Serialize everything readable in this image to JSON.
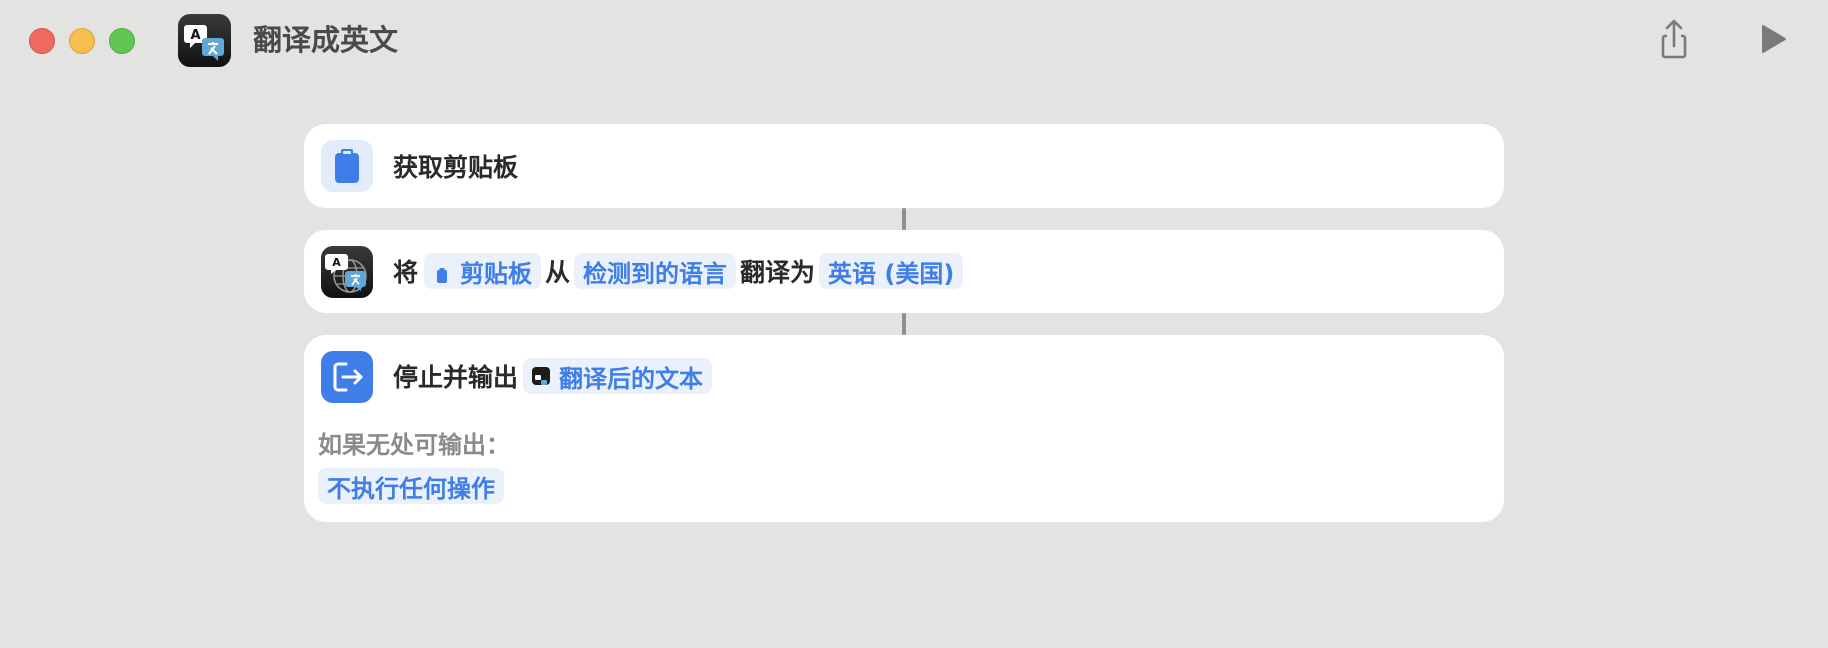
{
  "window": {
    "title": "翻译成英文",
    "traffic_lights": {
      "close": "#ee6a5f",
      "minimize": "#f5be4f",
      "zoom": "#62c655"
    },
    "share_icon": "share-icon",
    "run_icon": "play-icon"
  },
  "actions": [
    {
      "icon": "clipboard-icon",
      "text": "获取剪贴板"
    },
    {
      "icon": "translate-icon",
      "prefix": "将",
      "input_token": "剪贴板",
      "from_word": "从",
      "source_language": "检测到的语言",
      "to_word": "翻译为",
      "target_language": "英语 (美国)"
    },
    {
      "icon": "exit-icon",
      "text": "停止并输出",
      "output_token": "翻译后的文本",
      "fallback_label": "如果无处可输出：",
      "fallback_value": "不执行任何操作"
    }
  ],
  "colors": {
    "accent": "#3f7ee8",
    "token_bg": "#ebf1fb",
    "background": "#e3e3e1",
    "connector": "#8e8e93"
  }
}
